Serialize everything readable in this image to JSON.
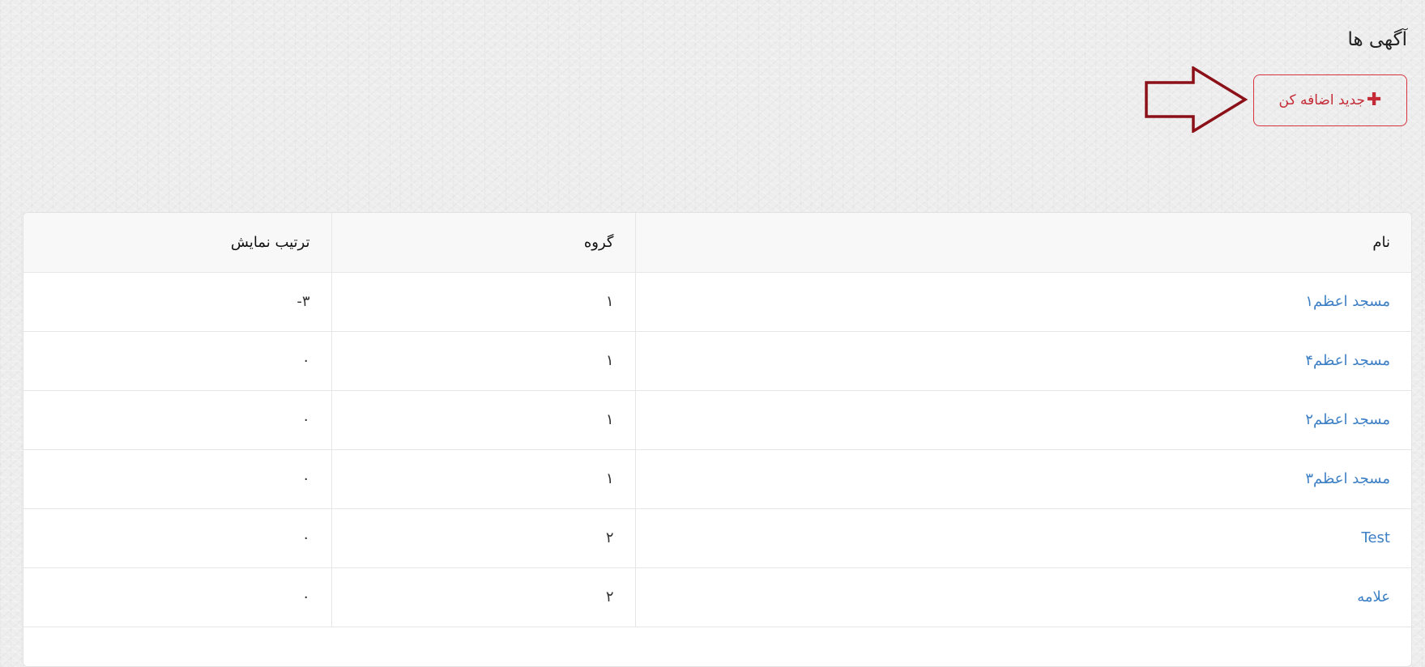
{
  "page": {
    "title": "آگهی ها"
  },
  "add_button": {
    "icon": "plus-icon",
    "icon_glyph": "✚",
    "label": "جدید اضافه کن"
  },
  "annotation": {
    "icon": "arrow-right-icon",
    "color": "#8b1018"
  },
  "table": {
    "headers": {
      "name": "نام",
      "group": "گروه",
      "order": "ترتیب نمایش"
    },
    "rows": [
      {
        "name": "مسجد اعظم۱",
        "group": "۱",
        "order": "۳-"
      },
      {
        "name": "مسجد اعظم۴",
        "group": "۱",
        "order": "۰"
      },
      {
        "name": "مسجد اعظم۲",
        "group": "۱",
        "order": "۰"
      },
      {
        "name": "مسجد اعظم۳",
        "group": "۱",
        "order": "۰"
      },
      {
        "name": "Test",
        "group": "۲",
        "order": "۰"
      },
      {
        "name": "علامه",
        "group": "۲",
        "order": "۰"
      }
    ]
  },
  "colors": {
    "accent_red": "#c42b36",
    "link_blue": "#3d7fc4"
  }
}
